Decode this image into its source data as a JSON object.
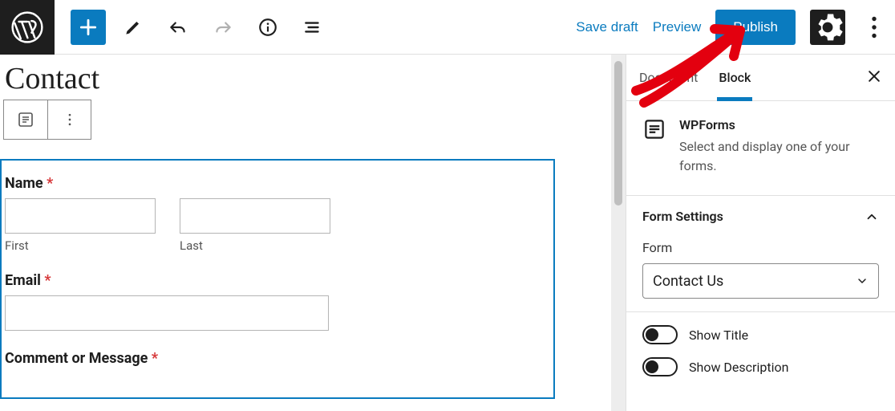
{
  "toolbar": {
    "save_draft": "Save draft",
    "preview": "Preview",
    "publish": "Publish"
  },
  "page": {
    "title": "Contact"
  },
  "form_block": {
    "fields": {
      "name": {
        "label": "Name",
        "required": "*",
        "first_sub": "First",
        "last_sub": "Last"
      },
      "email": {
        "label": "Email",
        "required": "*"
      },
      "comment": {
        "label": "Comment or Message",
        "required": "*"
      }
    }
  },
  "sidebar": {
    "tabs": {
      "document": "Document",
      "block": "Block"
    },
    "block_info": {
      "title": "WPForms",
      "description": "Select and display one of your forms."
    },
    "form_settings": {
      "section_title": "Form Settings",
      "form_label": "Form",
      "selected_form": "Contact Us",
      "show_title_label": "Show Title",
      "show_description_label": "Show Description"
    }
  }
}
